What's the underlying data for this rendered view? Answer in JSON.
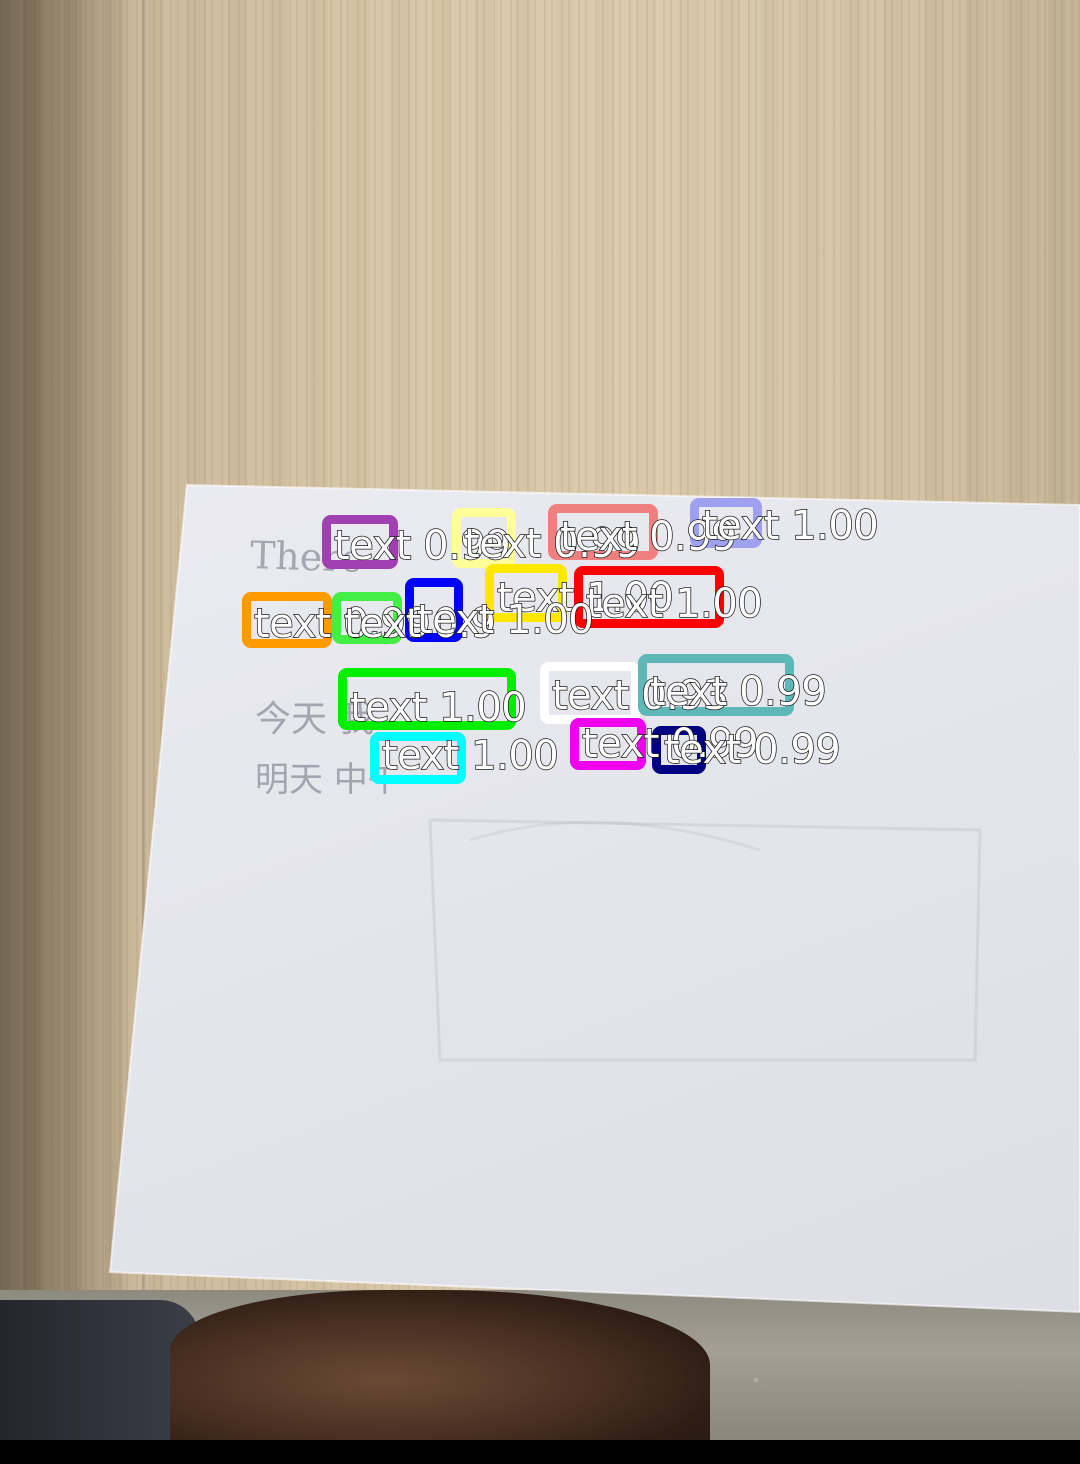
{
  "scene": {
    "handwriting": {
      "line1": "There",
      "line3": "今天 我",
      "line4": "明天 中午"
    }
  },
  "detections": [
    {
      "label": "text 0.99",
      "color": "#a040b0"
    },
    {
      "label": "text 0.99",
      "color": "#ffff99"
    },
    {
      "label": "text 0.99",
      "color": "#f08080"
    },
    {
      "label": "text 1.00",
      "color": "#a0a0f0"
    },
    {
      "label": "text 1.00",
      "color": "#ffe800"
    },
    {
      "label": "text 1.00",
      "color": "#ff0000"
    },
    {
      "label": "text 0.99",
      "color": "#ff9a00"
    },
    {
      "label": "text 0.9",
      "color": "#44ee44"
    },
    {
      "label": "text 1.00",
      "color": "#0000ff"
    },
    {
      "label": "text 1.00",
      "color": "#00ee00"
    },
    {
      "label": "text 0.93",
      "color": "#ffffff"
    },
    {
      "label": "text 0.99",
      "color": "#5fb8b8"
    },
    {
      "label": "text 1.00",
      "color": "#00ffff"
    },
    {
      "label": "text 0.99",
      "color": "#ee00ee"
    },
    {
      "label": "text 0.99",
      "color": "#000080"
    }
  ]
}
